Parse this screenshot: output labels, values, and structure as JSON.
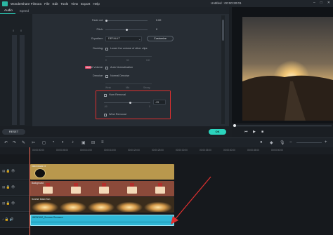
{
  "app": {
    "name": "Wondershare Filmora",
    "menu": [
      "File",
      "Edit",
      "Tools",
      "View",
      "Export",
      "Help"
    ],
    "title": "Untitled : 00:00:30:01"
  },
  "tabs": [
    {
      "label": "Audio"
    },
    {
      "label": "Speed"
    }
  ],
  "audio": {
    "fade_out_label": "Fade out:",
    "fade_out_value": "0.00",
    "pitch_label": "Pitch:",
    "pitch_value": "0",
    "equalizer_label": "Equalizer:",
    "equalizer_value": "DEFAULT",
    "customize_label": "Customize",
    "ducking_label": "Ducking:",
    "ducking_check": "Lower the volume of other clips",
    "ducking_scale_left": "0",
    "ducking_scale_mid": "50",
    "ducking_scale_right": "100",
    "ai_badge": "NEW",
    "ai_volume_label": "AI Volume:",
    "auto_normalization": "Auto Normalization",
    "denoise_label": "Denoise:",
    "normal_denoise": "Normal Denoise",
    "denoise_scale": [
      "Weak",
      "Mid",
      "Strong"
    ],
    "hum_removal": "Hum Removal",
    "hum_value": "-25",
    "hum_min": "-60",
    "hum_max": "0",
    "wind_removal": "Wind Removal"
  },
  "buttons": {
    "reset": "RESET",
    "ok": "OK"
  },
  "meter_labels": [
    "0",
    "0"
  ],
  "ruler": [
    "00:00:00:00",
    "00:00:05:00",
    "00:00:10:00",
    "00:00:15:00",
    "00:00:20:00",
    "00:00:25:00",
    "00:00:30:00",
    "00:00:35:00",
    "00:00:40:00",
    "00:00:45:00",
    "00:00:50:00"
  ],
  "clips": {
    "track1": "Intermission 3",
    "track2": "Background",
    "track3": "Sunrise Dawn Sun",
    "track4": "WEDDING_Summer Romance"
  },
  "colors": {
    "accent": "#2bd4bd",
    "highlight": "#e0302f",
    "track_gold": "#b9984d",
    "track_brown": "#8b4a3a",
    "track_cyan": "#2fb7d6"
  }
}
